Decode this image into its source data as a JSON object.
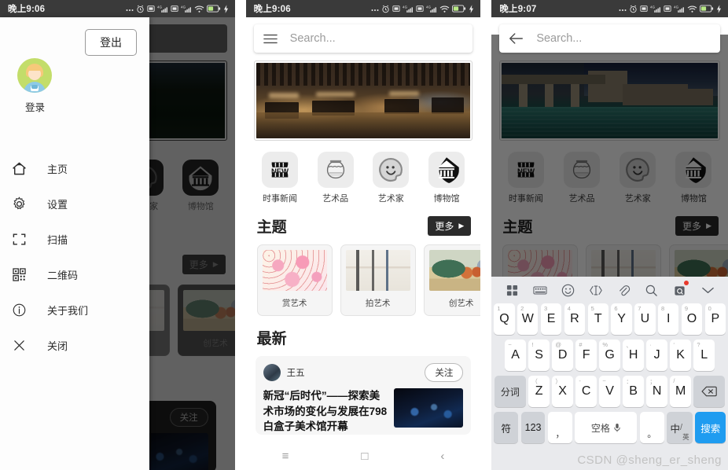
{
  "panels": [
    {
      "status": {
        "time": "晚上9:06"
      },
      "drawer": {
        "logout_label": "登出",
        "avatar_label": "登录",
        "items": [
          {
            "icon": "home-icon",
            "label": "主页"
          },
          {
            "icon": "gear-icon",
            "label": "设置"
          },
          {
            "icon": "scan-icon",
            "label": "扫描"
          },
          {
            "icon": "qrcode-icon",
            "label": "二维码"
          },
          {
            "icon": "info-icon",
            "label": "关于我们"
          },
          {
            "icon": "close-icon",
            "label": "关闭"
          }
        ]
      },
      "background": {
        "categories": [
          "艺术家",
          "博物馆"
        ],
        "more_label": "更多",
        "theme_name": "创艺术",
        "follow_label": "关注"
      }
    },
    {
      "status": {
        "time": "晚上9:06"
      },
      "search": {
        "placeholder": "Search...",
        "left_icon": "hamburger-icon"
      },
      "categories": [
        {
          "label": "时事新闻",
          "icon": "news-icon"
        },
        {
          "label": "艺术品",
          "icon": "vase-icon"
        },
        {
          "label": "艺术家",
          "icon": "palette-face-icon"
        },
        {
          "label": "博物馆",
          "icon": "museum-icon"
        }
      ],
      "theme_section": {
        "title": "主题",
        "more_label": "更多"
      },
      "themes": [
        {
          "name": "赏艺术"
        },
        {
          "name": "拍艺术"
        },
        {
          "name": "创艺术"
        }
      ],
      "latest_section": {
        "title": "最新"
      },
      "news": {
        "author": "王五",
        "follow_label": "关注",
        "title": "新冠“后时代”——探索美术市场的变化与发展在798白盒子美术馆开幕"
      }
    },
    {
      "status": {
        "time": "晚上9:07"
      },
      "search": {
        "placeholder": "Search...",
        "left_icon": "back-arrow-icon"
      },
      "categories": [
        {
          "label": "时事新闻",
          "icon": "news-icon"
        },
        {
          "label": "艺术品",
          "icon": "vase-icon"
        },
        {
          "label": "艺术家",
          "icon": "palette-face-icon"
        },
        {
          "label": "博物馆",
          "icon": "museum-icon"
        }
      ],
      "theme_section": {
        "title": "主题",
        "more_label": "更多"
      },
      "keyboard": {
        "toolbar": [
          "grid-icon",
          "keyboard-icon",
          "emoji-icon",
          "cursor-move-icon",
          "clip-icon",
          "search-icon",
          "camera-translate-icon",
          "chevron-down-icon"
        ],
        "row1": [
          {
            "key": "Q",
            "hint": "1"
          },
          {
            "key": "W",
            "hint": "2"
          },
          {
            "key": "E",
            "hint": "3"
          },
          {
            "key": "R",
            "hint": "4"
          },
          {
            "key": "T",
            "hint": "5"
          },
          {
            "key": "Y",
            "hint": "6"
          },
          {
            "key": "U",
            "hint": "7"
          },
          {
            "key": "I",
            "hint": "8"
          },
          {
            "key": "O",
            "hint": "9"
          },
          {
            "key": "P",
            "hint": "0"
          }
        ],
        "row2": [
          {
            "key": "A",
            "hint": "~"
          },
          {
            "key": "S",
            "hint": "!"
          },
          {
            "key": "D",
            "hint": "@"
          },
          {
            "key": "F",
            "hint": "#"
          },
          {
            "key": "G",
            "hint": "%"
          },
          {
            "key": "H",
            "hint": "、"
          },
          {
            "key": "J",
            "hint": "·"
          },
          {
            "key": "K",
            "hint": "‘"
          },
          {
            "key": "L",
            "hint": "?"
          }
        ],
        "row3_left": "分词",
        "row3": [
          {
            "key": "Z",
            "hint": "（"
          },
          {
            "key": "X",
            "hint": "）"
          },
          {
            "key": "C",
            "hint": "-"
          },
          {
            "key": "V",
            "hint": "~"
          },
          {
            "key": "B",
            "hint": "："
          },
          {
            "key": "N",
            "hint": "；"
          },
          {
            "key": "M",
            "hint": "/"
          }
        ],
        "row3_right": "backspace-icon",
        "row4": {
          "symbol": "符",
          "numbers": "123",
          "comma": "，",
          "space": "空格",
          "space_icon": "mic-icon",
          "period": "。",
          "lang_primary": "中",
          "lang_secondary": "英",
          "search": "搜索"
        }
      }
    }
  ],
  "navbar": {
    "recent": "≡",
    "home": "□",
    "back": "‹"
  },
  "watermark": "CSDN @sheng_er_sheng"
}
